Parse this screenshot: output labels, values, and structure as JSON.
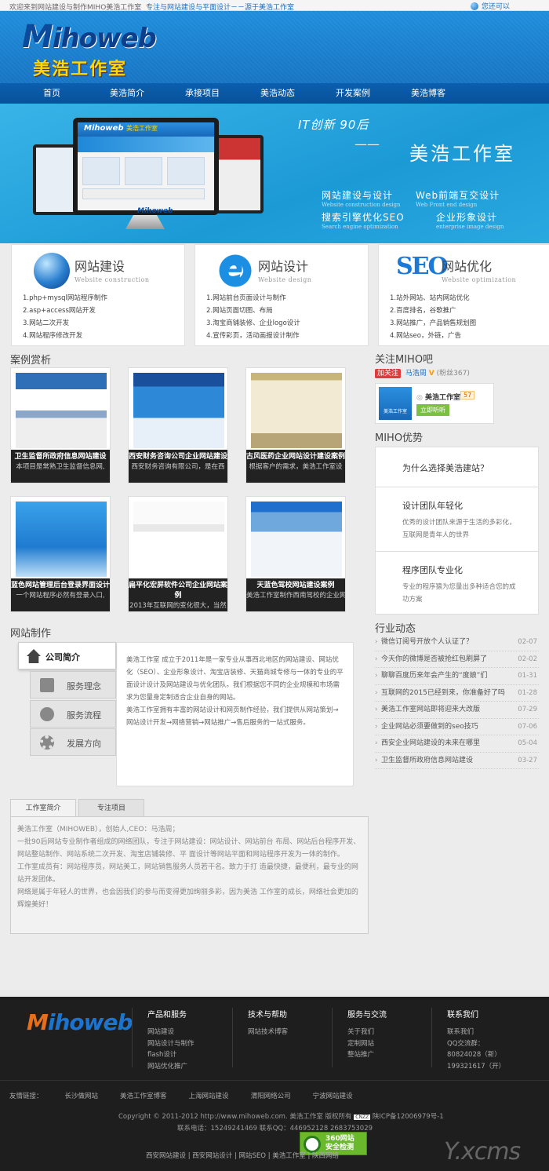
{
  "topbar": {
    "welcome": "欢迎来到网站建设与制作MIHO美浩工作室",
    "slogan": "专注与网站建设与平面设计－－源于美浩工作室",
    "fav": "您还可以"
  },
  "logo": {
    "brand_m": "M",
    "brand_rest": "ihoweb",
    "cn": "美浩工作室"
  },
  "nav": [
    "首页",
    "美浩简介",
    "承接项目",
    "美浩动态",
    "开发案例",
    "美浩博客"
  ],
  "banner": {
    "tag": "IT创新  90后",
    "title": "美浩工作室",
    "dash": "——",
    "items": [
      {
        "cn": "网站建设与设计",
        "en": "Website construction design"
      },
      {
        "cn": "Web前端互交设计",
        "en": "Web Front end design"
      },
      {
        "cn": "搜索引擎优化SEO",
        "en": "Search engine optimization"
      },
      {
        "cn": "企业形象设计",
        "en": "enterprise image design"
      }
    ],
    "screen_logo": "Mihoweb",
    "screen_sub": "美浩工作室",
    "base_logo": "Mihoweb"
  },
  "services": [
    {
      "title": "网站建设",
      "en": "Website construction",
      "icon": "globe-icon",
      "items": [
        "1.php+mysql网站程序制作",
        "2.asp+access网站开发",
        "3.网站二次开发",
        "4.网站程序修改开发"
      ]
    },
    {
      "title": "网站设计",
      "en": "Website design",
      "icon": "ie-icon",
      "items": [
        "1.网站前台页面设计与制作",
        "2.网站页面切图、布局",
        "3.淘宝商铺装修、企业logo设计",
        "4.宣传彩页，活动画报设计制作"
      ]
    },
    {
      "title": "网站优化",
      "en": "Website optimization",
      "icon": "seo-icon",
      "items": [
        "1.站外网站、站内网站优化",
        "2.百度排名，谷歌推广",
        "3.网站推广，产品销售规划图",
        "4.网站seo，外链，广告"
      ]
    }
  ],
  "cases": {
    "title": "案例赏析",
    "items": [
      {
        "name": "卫生监督所政府信息网站建设",
        "desc": "本项目是常熟卫生监督信息网,"
      },
      {
        "name": "西安财务咨询公司企业网站建设",
        "desc": "西安财务咨询有限公司，是在西"
      },
      {
        "name": "古风医药企业网站设计建设案例",
        "desc": "根据客户的需求，美浩工作室设"
      },
      {
        "name": "蓝色网站管理后台登录界面设计",
        "desc": "一个网站程序必然有登录入口,"
      },
      {
        "name": "扁平化宏屏软件公司企业网站案例",
        "desc": "2013年互联网的变化很大，当然"
      },
      {
        "name": "天蓝色驾校网站建设案例",
        "desc": "美浩工作室制作西南驾校的企业网站建设采用天蓝色和企业的"
      }
    ]
  },
  "weibo": {
    "title": "关注MIHO吧",
    "follow": "加关注",
    "name": "马浩周",
    "fans": "(粉丝367)",
    "card_name": "美浩工作室",
    "card_count": "57",
    "card_btn": "立即听听",
    "thumb": "美浩工作室"
  },
  "advantage": {
    "title": "MIHO优势",
    "q": "为什么选择美浩建站？",
    "items": [
      {
        "h": "设计团队年轻化",
        "p": "优秀的设计团队来源于生活的多彩化，互联网是青年人的世界"
      },
      {
        "h": "程序团队专业化",
        "p": "专业的程序猿为您量出多种适合您的成功方案"
      }
    ]
  },
  "news": {
    "title": "行业动态",
    "items": [
      {
        "t": "微信订阅号开放个人认证了？",
        "d": "02-07"
      },
      {
        "t": "今天你的微博是否被抢红包刷屏了",
        "d": "02-02"
      },
      {
        "t": "聊聊百度历来年会产生的“度娘”们",
        "d": "01-31"
      },
      {
        "t": "互联网的2015已经到来，你准备好了吗",
        "d": "01-28"
      },
      {
        "t": "美浩工作室网站即将迎来大改版",
        "d": "07-29"
      },
      {
        "t": "企业网站必须要做到的seo技巧",
        "d": "07-06"
      },
      {
        "t": "西安企业网站建设的未来在哪里",
        "d": "05-04"
      },
      {
        "t": "卫生监督所政府信息网站建设",
        "d": "03-27"
      }
    ]
  },
  "making": {
    "title": "网站制作",
    "tabs": [
      {
        "label": "公司简介",
        "icon": "home-icon"
      },
      {
        "label": "服务理念",
        "icon": "document-icon"
      },
      {
        "label": "服务流程",
        "icon": "search-icon"
      },
      {
        "label": "发展方向",
        "icon": "gear-icon"
      }
    ],
    "text": "美浩工作室 成立于2011年是一家专业从事西北地区的网站建设、网站优化（SEO）、企业形象设计、淘宝店装修、天猫商城专修与一体的专业的平面设计设计及网站建设与优化团队。我们根据您不同的企业规模和市场需求为您量身定制适合企业自身的网站。",
    "text2": "美浩工作室拥有丰富的网站设计和网页制作经验，我们提供从网站策划→网站设计开发→网络营销→网站推广→售后服务的一站式服务。"
  },
  "intro": {
    "tabs": [
      "工作室简介",
      "专注项目"
    ],
    "paras": [
      "美浩工作室（MIHOWEB），创始人,CEO：马浩周；",
      "一批90后网站专业制作者组成的网络团队，专注于网站建设：网站设计、网站前台 布局、网站后台程序开发、网站整站制作、网站系统二次开发、淘宝店铺装修、平 面设计等网站平面和网站程序开发为一体的制作。",
      "工作室成员有：网站程序员，网站美工，网站销售服务人员若干名。致力于打 造最快捷，最便利，最专业的网站开发团体。",
      "网络是属于年轻人的世界，也会因我们的参与而变得更加绚丽多彩，因为美浩 工作室的成长，网络社会更加的辉煌美好！"
    ]
  },
  "footer": {
    "logo": "Mihoweb",
    "cols": [
      {
        "h": "产品和服务",
        "items": [
          "网站建设",
          "网站设计与制作",
          "flash设计",
          "网站优化推广"
        ]
      },
      {
        "h": "技术与帮助",
        "items": [
          "网站技术博客"
        ]
      },
      {
        "h": "服务与交流",
        "items": [
          "关于我们",
          "定制网站",
          "整站推广"
        ]
      },
      {
        "h": "联系我们",
        "items": [
          "联系我们",
          "QQ交流群：",
          "80824028（新）",
          "199321617（开）"
        ]
      }
    ],
    "links_label": "友情链接：",
    "links": [
      "长沙做网站",
      "美浩工作室博客",
      "上海网站建设",
      "渭阳网络公司",
      "宁波网站建设"
    ],
    "copyright": "Copyright © 2011-2012 http://www.mihoweb.com. 美浩工作室 版权所有",
    "icp": "陕ICP备12006979号-1",
    "cnzz": "CNZZ",
    "contact": "联系电话：15249241469      联系QQ：446952128     2683753029",
    "bottom": "西安网站建设 | 西安网站设计 | 网站SEO | 美浩工作室 | 陕西网络",
    "security": "360网站\n安全检测",
    "security1": "360网站",
    "security2": "安全检测",
    "yxcms": "Y.xcms"
  }
}
